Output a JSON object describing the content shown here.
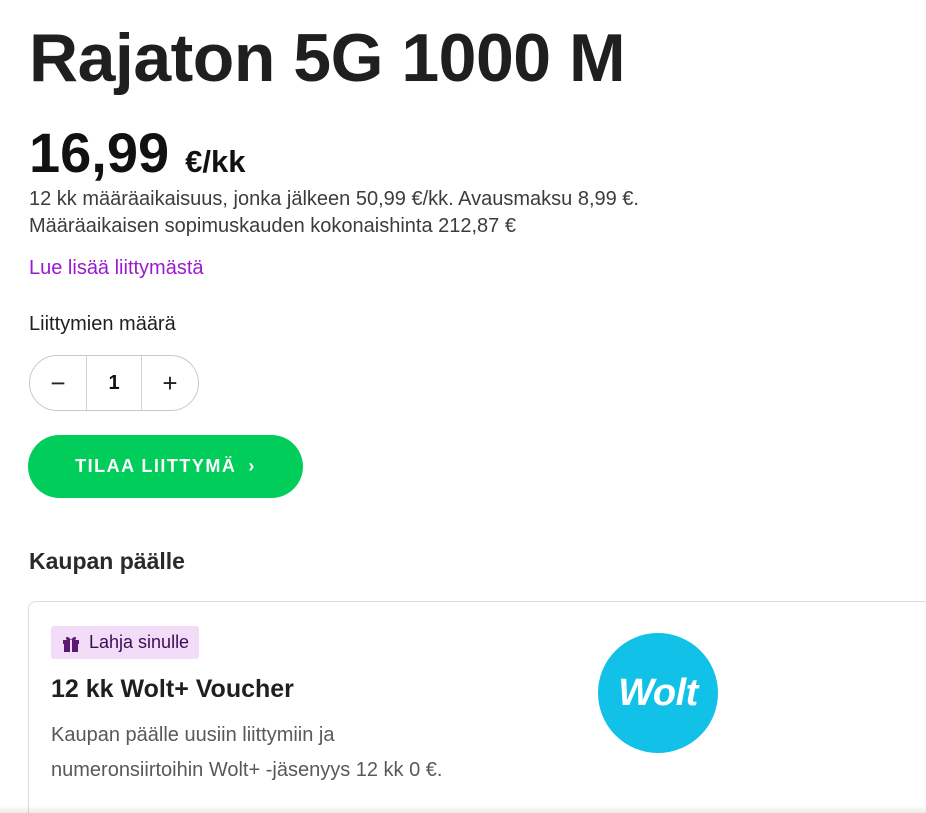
{
  "product": {
    "title": "Rajaton 5G 1000 M",
    "price": "16,99",
    "price_unit": "€/kk",
    "terms_line1": "12 kk määräaikaisuus, jonka jälkeen 50,99 €/kk. Avausmaksu 8,99 €.",
    "terms_line2": "Määräaikaisen sopimuskauden kokonaishinta 212,87 €",
    "read_more_link": "Lue lisää liittymästä"
  },
  "quantity": {
    "label": "Liittymien määrä",
    "value": "1",
    "decrement_symbol": "−",
    "increment_symbol": "+"
  },
  "order_button": {
    "label": "TILAA LIITTYMÄ",
    "chevron": "›"
  },
  "offer": {
    "section_title": "Kaupan päälle",
    "badge_label": "Lahja sinulle",
    "badge_icon": "gift-icon",
    "title": "12 kk Wolt+ Voucher",
    "desc_line1": "Kaupan päälle uusiin liittymiin ja",
    "desc_line2": "numeronsiirtoihin Wolt+ -jäsenyys 12 kk 0 €.",
    "logo_text": "Wolt"
  },
  "colors": {
    "accent_green": "#00cd5a",
    "link_purple": "#9b1ad0",
    "badge_bg": "#f3dcf7",
    "wolt_blue": "#12c1e8"
  }
}
